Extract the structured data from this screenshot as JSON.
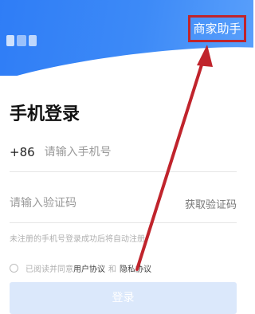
{
  "header": {
    "merchant_assistant_label": "商家助手",
    "accent_color": "#2f7df6"
  },
  "login": {
    "title": "手机登录",
    "country_code": "+86",
    "phone_placeholder": "请输入手机号",
    "code_placeholder": "请输入验证码",
    "get_code_label": "获取验证码",
    "hint": "未注册的手机号登录成功后将自动注册",
    "agreement_prefix": "已阅读并同意",
    "user_agreement": "用户协议",
    "and": "和",
    "privacy_agreement": "隐私协议",
    "submit_label": "登录"
  },
  "annotation": {
    "highlight_color": "#c0242c"
  }
}
